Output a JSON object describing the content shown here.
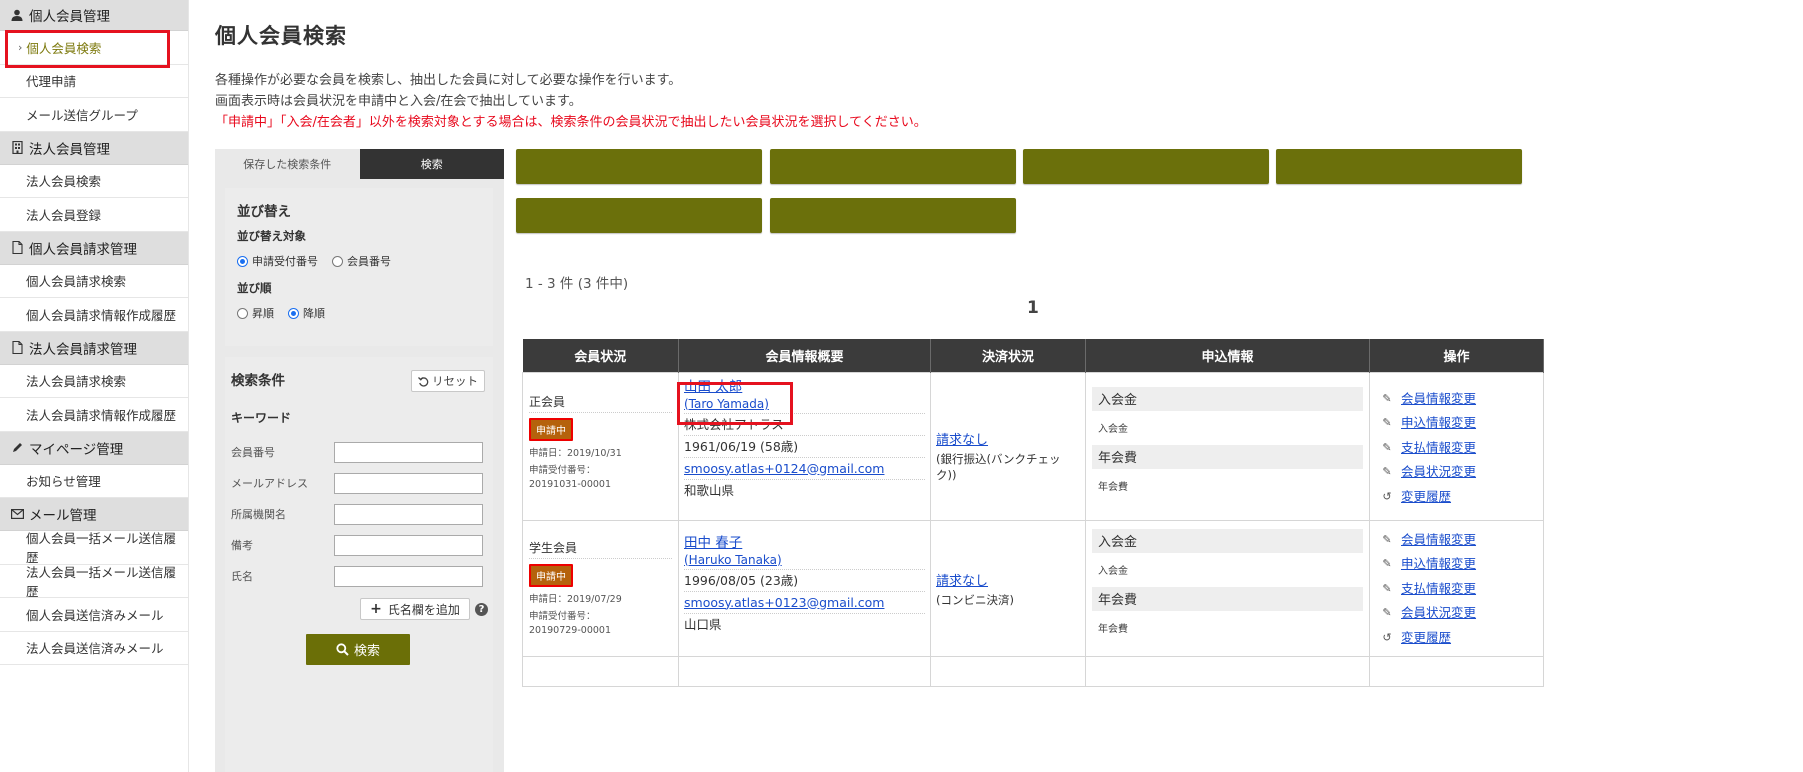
{
  "sidebar": {
    "sections": [
      {
        "label": "個人会員管理",
        "icon": "person-icon",
        "items": [
          "個人会員検索",
          "代理申請",
          "メール送信グループ"
        ]
      },
      {
        "label": "法人会員管理",
        "icon": "building-icon",
        "items": [
          "法人会員検索",
          "法人会員登録"
        ]
      },
      {
        "label": "個人会員請求管理",
        "icon": "document-icon",
        "items": [
          "個人会員請求検索",
          "個人会員請求情報作成履歴"
        ]
      },
      {
        "label": "法人会員請求管理",
        "icon": "document-icon",
        "items": [
          "法人会員請求検索",
          "法人会員請求情報作成履歴"
        ]
      },
      {
        "label": "マイページ管理",
        "icon": "pencil-icon",
        "items": [
          "お知らせ管理"
        ]
      },
      {
        "label": "メール管理",
        "icon": "envelope-icon",
        "items": [
          "個人会員一括メール送信履歴",
          "法人会員一括メール送信履歴",
          "個人会員送信済みメール",
          "法人会員送信済みメール"
        ]
      }
    ],
    "active_chevron": "›"
  },
  "page": {
    "title": "個人会員検索",
    "desc1": "各種操作が必要な会員を検索し、抽出した会員に対して必要な操作を行います。",
    "desc2": "画面表示時は会員状況を申請中と入会/在会で抽出しています。",
    "desc_warn": "「申請中」「入会/在会者」以外を検索対象とする場合は、検索条件の会員状況で抽出したい会員状況を選択してください。"
  },
  "panel": {
    "tab_saved": "保存した検索条件",
    "tab_search": "検索",
    "sort_title": "並び替え",
    "sort_target_label": "並び替え対象",
    "sort_target_opt1": "申請受付番号",
    "sort_target_opt2": "会員番号",
    "sort_order_label": "並び順",
    "sort_order_opt1": "昇順",
    "sort_order_opt2": "降順",
    "cond_title": "検索条件",
    "reset_label": "リセット",
    "keyword_label": "キーワード",
    "fields": [
      "会員番号",
      "メールアドレス",
      "所属機関名",
      "備考",
      "氏名"
    ],
    "add_name_label": "氏名欄を追加",
    "search_label": "検索"
  },
  "results": {
    "count": "1 - 3 件 (3 件中)",
    "page_number": "1",
    "headers": [
      "会員状況",
      "会員情報概要",
      "決済状況",
      "申込情報",
      "操作"
    ],
    "rows": [
      {
        "status": "正会員",
        "badge": "申請中",
        "apply_date": "申請日：2019/10/31",
        "receipt_label": "申請受付番号：",
        "receipt_no": "20191031-00001",
        "name": "山田 太郎",
        "roman": "(Taro Yamada)",
        "org": "株式会社アトラス",
        "birth": "1961/06/19 (58歳)",
        "email": "smoosy.atlas+0124@gmail.com",
        "pref": "和歌山県",
        "pay_status": "請求なし",
        "pay_method": "(銀行振込(バンクチェック))",
        "fee1_head": "入会金",
        "fee1_sub": "入会金",
        "fee2_head": "年会費",
        "fee2_sub": "年会費"
      },
      {
        "status": "学生会員",
        "badge": "申請中",
        "apply_date": "申請日：2019/07/29",
        "receipt_label": "申請受付番号：",
        "receipt_no": "20190729-00001",
        "name": "田中 春子",
        "roman": "(Haruko Tanaka)",
        "org": "",
        "birth": "1996/08/05 (23歳)",
        "email": "smoosy.atlas+0123@gmail.com",
        "pref": "山口県",
        "pay_status": "請求なし",
        "pay_method": "(コンビニ決済)",
        "fee1_head": "入会金",
        "fee1_sub": "入会金",
        "fee2_head": "年会費",
        "fee2_sub": "年会費"
      }
    ],
    "ops": [
      "会員情報変更",
      "申込情報変更",
      "支払情報変更",
      "会員状況変更",
      "変更履歴"
    ]
  },
  "colors": {
    "accent": "#6b700b",
    "highlight": "#e5121f",
    "badge": "#b5620c",
    "link": "#1a4dcc"
  }
}
